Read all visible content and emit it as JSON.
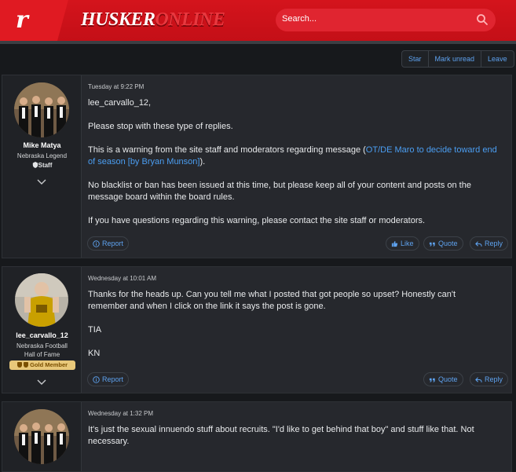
{
  "header": {
    "logo_letter": "r",
    "brand_part1": "HUSKER",
    "brand_part2": "ONLINE",
    "search_placeholder": "Search..."
  },
  "thread_actions": [
    "Star",
    "Mark unread",
    "Leave"
  ],
  "posts": [
    {
      "username": "Mike Matya",
      "user_title": "Nebraska Legend",
      "badge": "Staff",
      "date": "Tuesday at 9:22 PM",
      "paragraphs": [
        "lee_carvallo_12,",
        "Please stop with these type of replies.",
        "",
        "No blacklist or ban has been issued at this time, but please keep all of your content and posts on the message board within the board rules.",
        "If you have questions regarding this warning, please contact the site staff or moderators."
      ],
      "warning_prefix": "This is a warning from the site staff and moderators regarding message (",
      "warning_link": "OT/DE Maro to decide toward end of season [by Bryan Munson]",
      "warning_suffix": ").",
      "report_label": "Report",
      "like_label": "Like",
      "quote_label": "Quote",
      "reply_label": "Reply"
    },
    {
      "username": "lee_carvallo_12",
      "user_title_line1": "Nebraska Football",
      "user_title_line2": "Hall of Fame",
      "badge": "Gold Member",
      "date": "Wednesday at 10:01 AM",
      "paragraphs": [
        "Thanks for the heads up. Can you tell me what I posted that got people so upset? Honestly can't remember and when I click on the link it says the post is gone.",
        "TIA",
        "KN"
      ],
      "report_label": "Report",
      "quote_label": "Quote",
      "reply_label": "Reply"
    },
    {
      "date": "Wednesday at 1:32 PM",
      "paragraphs": [
        "It's just the sexual innuendo stuff about recruits. \"I'd like to get behind that boy\" and stuff like that. Not necessary."
      ]
    }
  ],
  "colors": {
    "header_red": "#c40f17",
    "accent_link": "#4b9ef2",
    "gold_badge": "#e8c87a"
  }
}
